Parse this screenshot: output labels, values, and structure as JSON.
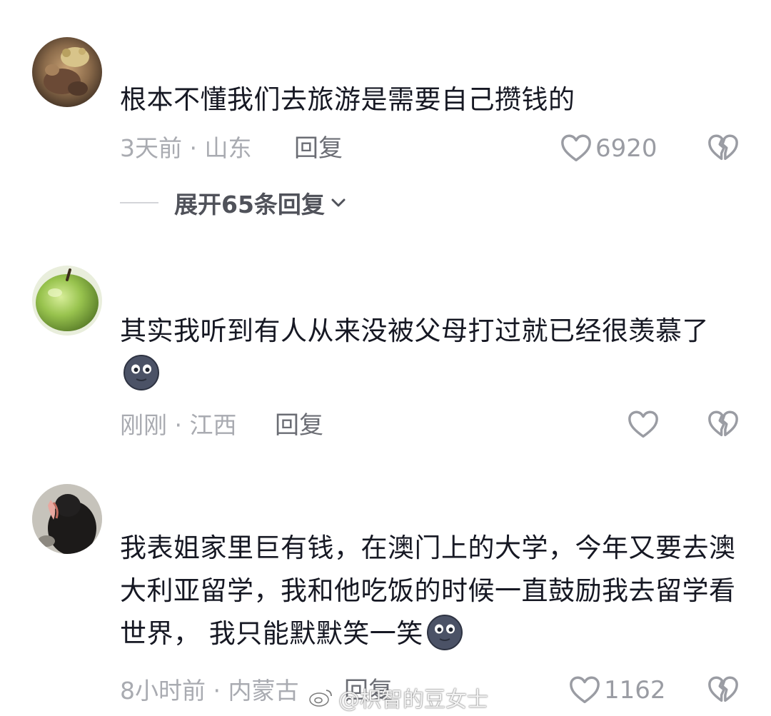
{
  "comments": [
    {
      "text": "根本不懂我们去旅游是需要自己攒钱的",
      "meta": "3天前 · 山东",
      "reply_label": "回复",
      "like_count": "6920",
      "expand_label": "展开65条回复"
    },
    {
      "text": "其实我听到有人从来没被父母打过就已经很羡慕了",
      "meta": "刚刚 · 江西",
      "reply_label": "回复",
      "like_count": ""
    },
    {
      "text": "我表姐家里巨有钱，在澳门上的大学，今年又要去澳大利亚留学，我和他吃饭的时候一直鼓励我去留学看世界， 我只能默默笑一笑",
      "meta": "8小时前 · 内蒙古",
      "reply_label": "回复",
      "like_count": "1162"
    }
  ],
  "watermark": "@枳智的豆女士",
  "icons": {
    "like": "heart-outline-icon",
    "dislike": "broken-heart-icon",
    "emoji": "blank-stare-emoji-icon",
    "expand": "chevron-down-icon"
  },
  "colors": {
    "text": "#161823",
    "meta": "#a9abb1",
    "reply": "#6b6d74",
    "icon": "#9a9ca3"
  }
}
